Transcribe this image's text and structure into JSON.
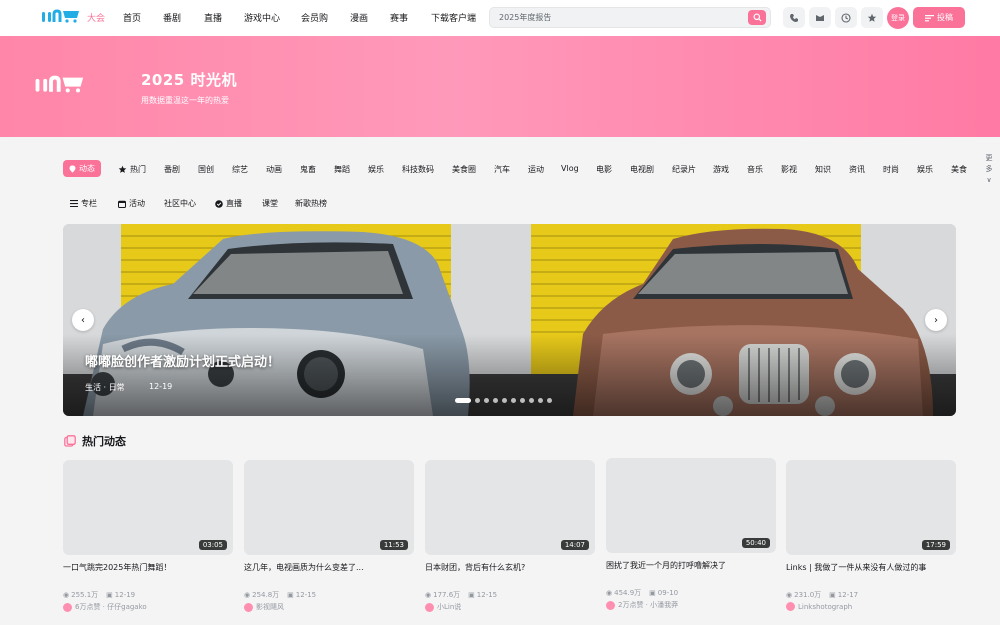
{
  "nav": {
    "items": [
      {
        "label": "大会",
        "active": true
      },
      {
        "label": "首页"
      },
      {
        "label": "番剧"
      },
      {
        "label": "直播"
      },
      {
        "label": "游戏中心"
      },
      {
        "label": "会员购"
      },
      {
        "label": "漫画"
      },
      {
        "label": "赛事"
      },
      {
        "label": "下载客户端"
      }
    ],
    "search_placeholder": "2025年度报告",
    "login_label": "登录",
    "upload_label": "投稿"
  },
  "banner": {
    "title": "2025 时光机",
    "subtitle": "用数据重温这一年的热爱"
  },
  "categories": {
    "row1": [
      "动态",
      "热门",
      "番剧",
      "国创",
      "综艺",
      "动画",
      "鬼畜",
      "舞蹈",
      "娱乐",
      "科技数码",
      "美食圈",
      "汽车",
      "运动",
      "Vlog",
      "电影",
      "电视剧",
      "纪录片",
      "游戏",
      "音乐",
      "影视",
      "知识",
      "资讯",
      "时尚",
      "娱乐",
      "美食"
    ],
    "row2": [
      "专栏",
      "活动",
      "社区中心",
      "直播",
      "课堂",
      "新歌热榜"
    ],
    "more_label": "更多"
  },
  "carousel": {
    "title": "嘟嘟脸创作者激励计划正式启动！",
    "meta": "生活 · 日常",
    "date": "12-19",
    "slide_count": 10,
    "active_index": 0
  },
  "section": {
    "title": "热门动态"
  },
  "videos": [
    {
      "duration": "03:05",
      "title": "一口气跳完2025年热门舞蹈！",
      "views": "255.1万",
      "date": "12-19",
      "author": "6万点赞 · 仔仔gagako"
    },
    {
      "duration": "11:53",
      "title": "这几年，电视画质为什么变差了...",
      "views": "254.8万",
      "date": "12-15",
      "author": "影视飓风"
    },
    {
      "duration": "14:07",
      "title": "日本财团，背后有什么玄机?",
      "views": "177.6万",
      "date": "12-15",
      "author": "小Lin说"
    },
    {
      "duration": "50:40",
      "title": "困扰了我近一个月的打呼噜解决了",
      "views": "454.9万",
      "date": "09-10",
      "author": "2万点赞 · 小潘我莽"
    },
    {
      "duration": "17:59",
      "title": "Links | 我做了一件从来没有人做过的事",
      "views": "231.0万",
      "date": "12-17",
      "author": "Linkshotograph"
    }
  ],
  "colors": {
    "accent": "#fb7299",
    "bg": "#f4f4f5"
  }
}
